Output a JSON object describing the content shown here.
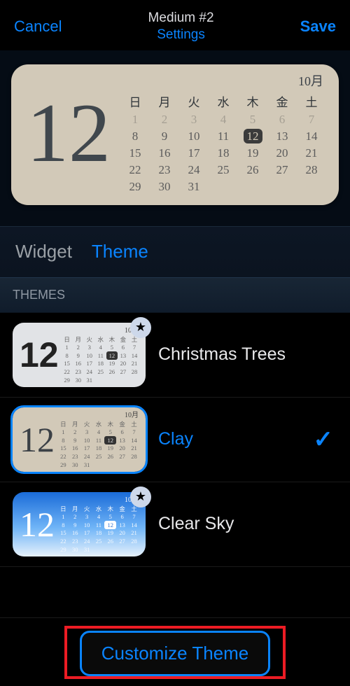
{
  "header": {
    "cancel": "Cancel",
    "title": "Medium #2",
    "subtitle": "Settings",
    "save": "Save"
  },
  "preview": {
    "big_day": "12",
    "month_label": "10月",
    "dow": [
      "日",
      "月",
      "火",
      "水",
      "木",
      "金",
      "土"
    ],
    "weeks": [
      [
        {
          "d": "1",
          "dim": true
        },
        {
          "d": "2",
          "dim": true
        },
        {
          "d": "3",
          "dim": true
        },
        {
          "d": "4",
          "dim": true
        },
        {
          "d": "5",
          "dim": true
        },
        {
          "d": "6",
          "dim": true
        },
        {
          "d": "7",
          "dim": true
        }
      ],
      [
        {
          "d": "8"
        },
        {
          "d": "9"
        },
        {
          "d": "10"
        },
        {
          "d": "11"
        },
        {
          "d": "12",
          "today": true
        },
        {
          "d": "13"
        },
        {
          "d": "14"
        }
      ],
      [
        {
          "d": "15"
        },
        {
          "d": "16"
        },
        {
          "d": "17"
        },
        {
          "d": "18"
        },
        {
          "d": "19"
        },
        {
          "d": "20"
        },
        {
          "d": "21"
        }
      ],
      [
        {
          "d": "22"
        },
        {
          "d": "23"
        },
        {
          "d": "24"
        },
        {
          "d": "25"
        },
        {
          "d": "26"
        },
        {
          "d": "27"
        },
        {
          "d": "28"
        }
      ],
      [
        {
          "d": "29"
        },
        {
          "d": "30"
        },
        {
          "d": "31"
        },
        {
          "d": ""
        },
        {
          "d": ""
        },
        {
          "d": ""
        },
        {
          "d": ""
        }
      ]
    ]
  },
  "tabs": {
    "widget": "Widget",
    "theme": "Theme"
  },
  "section": {
    "themes": "THEMES"
  },
  "themes": [
    {
      "id": "trees",
      "label": "Christmas Trees",
      "star": true,
      "selected": false,
      "style": "trees"
    },
    {
      "id": "clay",
      "label": "Clay",
      "star": false,
      "selected": true,
      "style": "clay"
    },
    {
      "id": "sky",
      "label": "Clear Sky",
      "star": true,
      "selected": false,
      "style": "sky"
    }
  ],
  "mini": {
    "big": "12",
    "month": "10月",
    "dow": [
      "日",
      "月",
      "火",
      "水",
      "木",
      "金",
      "土"
    ],
    "rows": [
      [
        "1",
        "2",
        "3",
        "4",
        "5",
        "6",
        "7"
      ],
      [
        "8",
        "9",
        "10",
        "11",
        "12",
        "13",
        "14"
      ],
      [
        "15",
        "16",
        "17",
        "18",
        "19",
        "20",
        "21"
      ],
      [
        "22",
        "23",
        "24",
        "25",
        "26",
        "27",
        "28"
      ],
      [
        "29",
        "30",
        "31",
        "",
        "",
        "",
        ""
      ]
    ],
    "today_index": [
      1,
      4
    ]
  },
  "cta": {
    "label": "Customize Theme"
  }
}
